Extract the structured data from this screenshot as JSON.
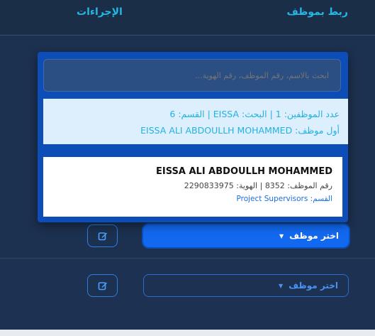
{
  "header": {
    "col_link": "ربط بموظف",
    "col_actions": "الإجراءات"
  },
  "rows": [
    {
      "select_label": "اختر موظف",
      "caret": "▼"
    },
    {
      "select_label": "اختر موظف",
      "caret": "▼"
    }
  ],
  "dropdown": {
    "search_placeholder": "ابحث بالاسم، رقم الموظف، رقم الهوية...",
    "summary_line": "عدد الموظفين: 1 | البحث: EISSA | القسم: 6",
    "first_employee_line": "أول موظف: EISSA ALI ABDOULLH MOHAMMED",
    "result": {
      "name": "EISSA ALI ABDOULLH MOHAMMED",
      "meta": "رقم الموظف: 8352 | الهوية: 2290833975",
      "dept_label": "القسم:",
      "dept_value": "Project Supervisors"
    }
  },
  "colors": {
    "accent": "#23b7e6",
    "primary": "#1269f0",
    "background": "#1c2f4a"
  }
}
